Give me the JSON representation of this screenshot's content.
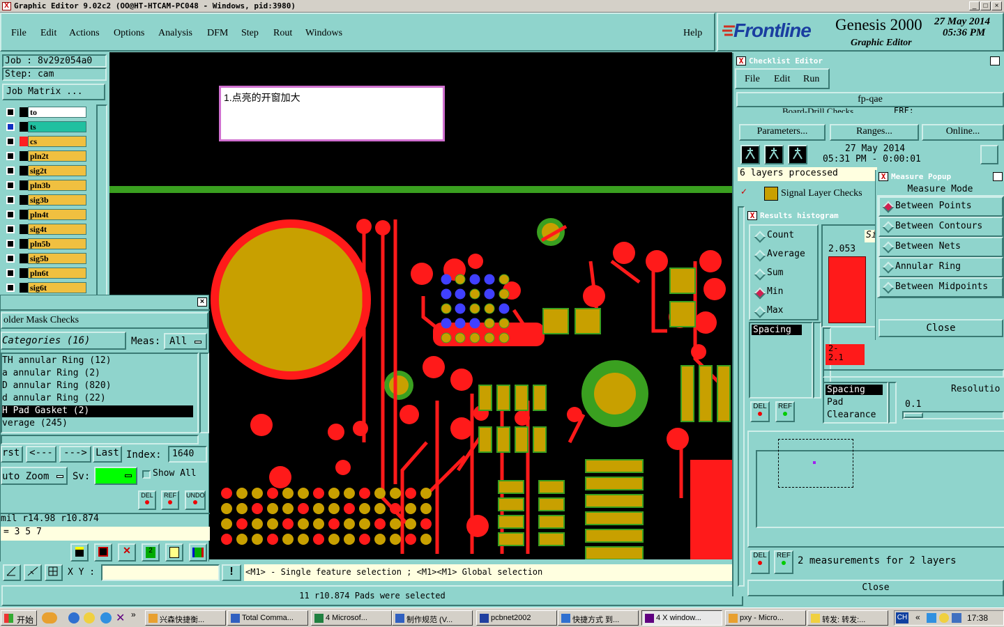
{
  "window": {
    "title": "Graphic Editor 9.02c2 (OO@HT-HTCAM-PC048 - Windows, pid:3980)"
  },
  "menu": {
    "file": "File",
    "edit": "Edit",
    "actions": "Actions",
    "options": "Options",
    "analysis": "Analysis",
    "dfm": "DFM",
    "step": "Step",
    "rout": "Rout",
    "windows": "Windows",
    "help": "Help"
  },
  "brand": {
    "logo": "Frontline",
    "product": "Genesis 2000",
    "subtitle": "Graphic Editor",
    "date": "27 May 2014",
    "time": "05:36 PM"
  },
  "job": {
    "job_label": "Job : 8v29z054a0",
    "step_label": "Step: cam",
    "matrix_btn": "Job Matrix ..."
  },
  "layers": [
    {
      "name": "to",
      "color": "#ffffff",
      "swatch": "#000000"
    },
    {
      "name": "ts",
      "color": "#20c0a0",
      "swatch": "#000000"
    },
    {
      "name": "cs",
      "color": "#f0c040",
      "swatch": "#ff2020"
    },
    {
      "name": "pln2t",
      "color": "#f0c040",
      "swatch": "#000000"
    },
    {
      "name": "sig2t",
      "color": "#f0c040",
      "swatch": "#000000"
    },
    {
      "name": "pln3b",
      "color": "#f0c040",
      "swatch": "#000000"
    },
    {
      "name": "sig3b",
      "color": "#f0c040",
      "swatch": "#000000"
    },
    {
      "name": "pln4t",
      "color": "#f0c040",
      "swatch": "#000000"
    },
    {
      "name": "sig4t",
      "color": "#f0c040",
      "swatch": "#000000"
    },
    {
      "name": "pln5b",
      "color": "#f0c040",
      "swatch": "#000000"
    },
    {
      "name": "sig5b",
      "color": "#f0c040",
      "swatch": "#000000"
    },
    {
      "name": "pln6t",
      "color": "#f0c040",
      "swatch": "#000000"
    },
    {
      "name": "sig6t",
      "color": "#f0c040",
      "swatch": "#000000"
    }
  ],
  "note": {
    "text": "1.点亮的开窗加大"
  },
  "smc": {
    "title": "older Mask Checks",
    "categories": "Categories (16)",
    "meas_label": "Meas:",
    "meas_value": "All",
    "items": [
      "TH annular Ring (12)",
      "a annular Ring (2)",
      "D annular Ring (820)",
      "d annular Ring (22)",
      "H Pad Gasket (2)",
      "verage (245)"
    ],
    "selected_index": 4,
    "nav": {
      "first": "rst",
      "prev": "<---",
      "next": "--->",
      "last": "Last",
      "index_label": "Index:",
      "index_value": "1640"
    },
    "zoom": "uto Zoom",
    "sv_label": "Sv:",
    "show_all": "Show All",
    "del": "DEL",
    "ref": "REF",
    "undo": "UNDO",
    "readout": "mil   r14.98   r10.874",
    "eq": "= 3 5 7"
  },
  "status": {
    "xy_label": "X Y :",
    "hint": "<M1> - Single feature selection ; <M1><M1> Global selection",
    "selected": "11 r10.874 Pads were selected"
  },
  "checklist": {
    "title": "Checklist Editor",
    "menu": {
      "file": "File",
      "edit": "Edit",
      "run": "Run"
    },
    "name": "fp-qae",
    "partial_row": "Board-Drill Checks",
    "partial_erf": "ERF:",
    "params": "Parameters...",
    "ranges": "Ranges...",
    "online": "Online...",
    "run_date": "27 May 2014",
    "run_time": "05:31 PM - 0:00:01",
    "processed": "6 layers processed",
    "signal": "Signal Layer Checks"
  },
  "histogram": {
    "title": "Results histogram",
    "modes": [
      "Count",
      "Average",
      "Sum",
      "Min",
      "Max"
    ],
    "selected_mode": "Min",
    "size_label": "Siz",
    "value": "2.053",
    "range_label": "2-\n2.1",
    "spacing_top": "Spacing",
    "list": [
      "Spacing",
      "Pad",
      "Clearance"
    ],
    "resolution_label": "Resolutio",
    "resolution_value": "0.1",
    "bar_fraction": 1.0
  },
  "measure": {
    "title": "Measure Popup",
    "mode_label": "Measure Mode",
    "options": [
      "Between Points",
      "Between Contours",
      "Between Nets",
      "Annular Ring",
      "Between Midpoints"
    ],
    "selected": "Between Points",
    "close": "Close"
  },
  "measurements": {
    "summary": "2 measurements for 2 layers",
    "close": "Close",
    "del": "DEL",
    "ref": "REF"
  },
  "taskbar": {
    "start": "开始",
    "tasks": [
      "兴森快捷衡...",
      "Total Comma...",
      "4 Microsof...",
      "制作规范 (V...",
      "pcbnet2002",
      "快捷方式 到...",
      "4 X window...",
      "pxy - Micro...",
      "转发: 转发:..."
    ],
    "lang": "CH",
    "clock": "17:38"
  },
  "colors": {
    "teal": "#8fd4cc",
    "copper": "#ff1a1a",
    "pad": "#c8a000",
    "green": "#3aa020",
    "blue": "#4040ff"
  }
}
